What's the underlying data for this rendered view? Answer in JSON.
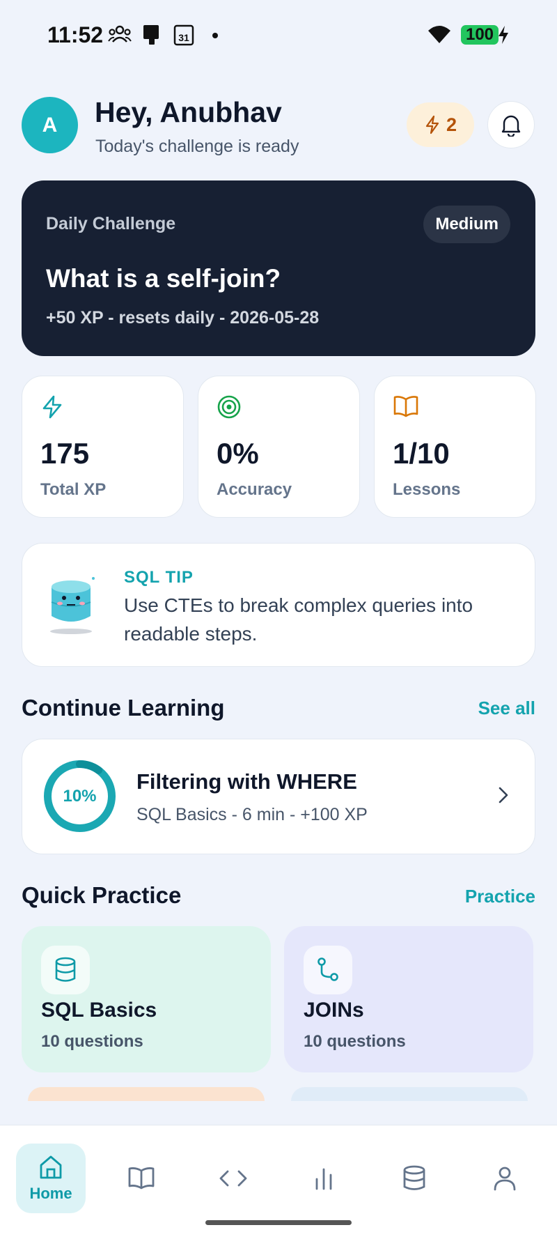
{
  "status_bar": {
    "time": "11:52",
    "battery": "100",
    "icons": [
      "people-icon",
      "phone-icon",
      "calendar-icon",
      "dot-icon",
      "wifi-icon",
      "battery-icon",
      "charging-icon"
    ],
    "calendar_day": "31"
  },
  "header": {
    "avatar_initial": "A",
    "greeting": "Hey, Anubhav",
    "subtitle": "Today's challenge is ready",
    "streak_count": "2"
  },
  "challenge": {
    "label": "Daily Challenge",
    "difficulty": "Medium",
    "question": "What is a self-join?",
    "meta": "+50 XP - resets daily - 2026-05-28"
  },
  "stats": [
    {
      "value": "175",
      "label": "Total XP",
      "icon": "bolt-icon",
      "color": "#14A3AE"
    },
    {
      "value": "0%",
      "label": "Accuracy",
      "icon": "target-icon",
      "color": "#16A34A"
    },
    {
      "value": "1/10",
      "label": "Lessons",
      "icon": "book-icon",
      "color": "#D97706"
    }
  ],
  "tip": {
    "label": "SQL TIP",
    "text": "Use CTEs to break complex queries into readable steps."
  },
  "continue_learning": {
    "title": "Continue Learning",
    "link": "See all",
    "lesson": {
      "progress_label": "10%",
      "progress": 0.1,
      "title": "Filtering with WHERE",
      "meta": "SQL Basics - 6 min - +100 XP"
    }
  },
  "quick_practice": {
    "title": "Quick Practice",
    "link": "Practice",
    "cards": [
      {
        "title": "SQL Basics",
        "count": "10 questions",
        "icon": "database-icon",
        "bg": "#DDF5EE"
      },
      {
        "title": "JOINs",
        "count": "10 questions",
        "icon": "join-icon",
        "bg": "#E5E7FB"
      }
    ]
  },
  "nav": {
    "items": [
      {
        "label": "Home",
        "icon": "home-icon",
        "active": true
      },
      {
        "label": "",
        "icon": "book-open-icon"
      },
      {
        "label": "",
        "icon": "code-icon"
      },
      {
        "label": "",
        "icon": "bar-chart-icon"
      },
      {
        "label": "",
        "icon": "database-icon"
      },
      {
        "label": "",
        "icon": "profile-icon"
      }
    ]
  },
  "colors": {
    "accent": "#14A3AE",
    "dark_card": "#172033",
    "background": "#EFF3FB"
  }
}
